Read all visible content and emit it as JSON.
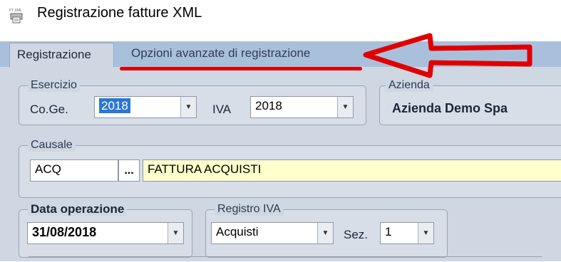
{
  "window": {
    "title": "Registrazione fatture XML",
    "icon": "printer-xml-icon",
    "icon_text": "FT XML"
  },
  "tabs": [
    {
      "label": "Registrazione",
      "active": true
    },
    {
      "label": "Opzioni avanzate di registrazione",
      "active": false
    }
  ],
  "annotation": {
    "color": "#e00000",
    "icon": "red-arrow-left-icon"
  },
  "esercizio": {
    "legend": "Esercizio",
    "coge_label": "Co.Ge.",
    "coge_value": "2018",
    "iva_label": "IVA",
    "iva_value": "2018"
  },
  "azienda": {
    "legend": "Azienda",
    "name": "Azienda Demo Spa"
  },
  "causale": {
    "legend": "Causale",
    "code": "ACQ",
    "lookup_label": "...",
    "description": "FATTURA ACQUISTI"
  },
  "data_operazione": {
    "legend": "Data operazione",
    "value": "31/08/2018"
  },
  "registro_iva": {
    "legend": "Registro IVA",
    "value": "Acquisti",
    "sez_label": "Sez.",
    "sez_value": "1"
  },
  "colors": {
    "accent": "#2a77d4",
    "highlight_field": "#ffffcc",
    "panel": "#cfd7e2",
    "tabstrip": "#a9c0dd"
  }
}
